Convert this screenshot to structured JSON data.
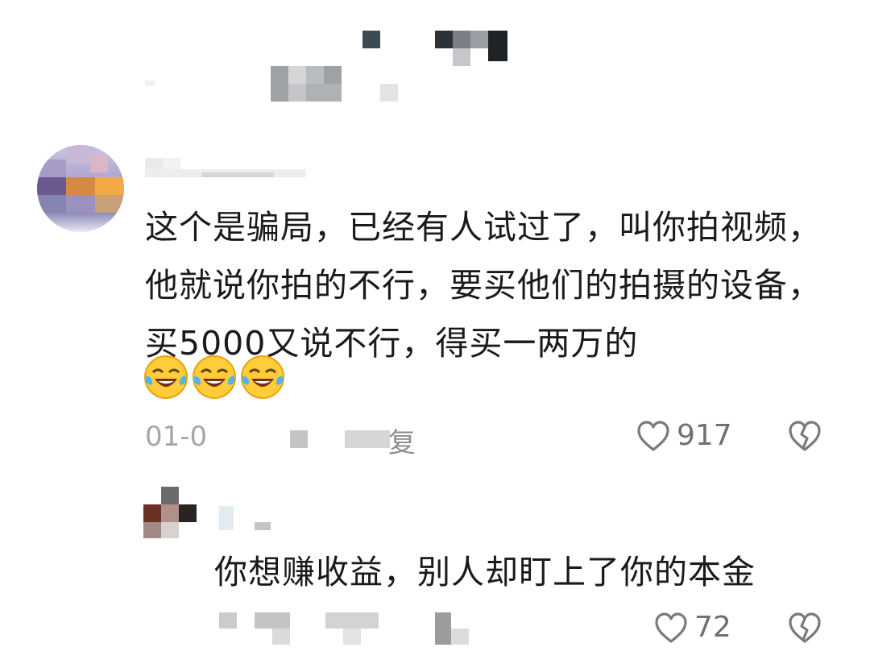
{
  "comment": {
    "text": "这个是骗局，已经有人试过了，叫你拍视频，他就说你拍的不行，要买他们的拍摄的设备，买5000又说不行，得买一两万的",
    "emojis": [
      "laugh-cry-emoji",
      "laugh-cry-emoji",
      "laugh-cry-emoji"
    ],
    "date": "01-0",
    "reply_fragment": "复",
    "likes": "917"
  },
  "reply": {
    "text": "你想赚收益，别人却盯上了你的本金",
    "likes": "72"
  },
  "icons": {
    "like": "heart-outline-icon",
    "dislike": "broken-heart-icon"
  },
  "colors": {
    "text": "#1a1a1a",
    "meta": "#a6a6a6",
    "count": "#707070"
  }
}
